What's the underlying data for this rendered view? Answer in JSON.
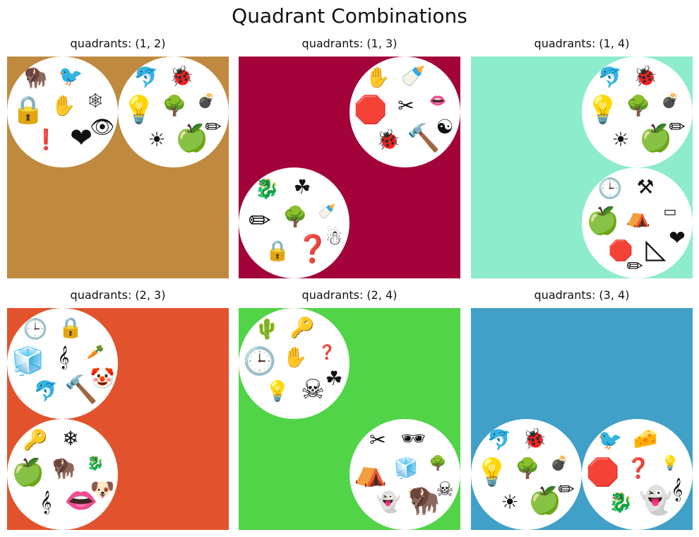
{
  "figure": {
    "title": "Quadrant Combinations"
  },
  "panels": [
    {
      "title": "quadrants: (1, 2)",
      "background": "#bf8a3f",
      "cards": [
        {
          "quadrant": 1,
          "symbols": [
            "bison-icon",
            "bird-icon",
            "lock-icon",
            "hand-icon",
            "spiderweb-icon",
            "exclamation-icon",
            "heart-icon",
            "eye-icon"
          ]
        },
        {
          "quadrant": 2,
          "symbols": [
            "dolphin-icon",
            "ladybug-icon",
            "lightbulb-icon",
            "tree-icon",
            "bomb-icon",
            "sun-icon",
            "apple-icon",
            "pencil-icon"
          ]
        }
      ]
    },
    {
      "title": "quadrants: (1, 3)",
      "background": "#a3023b",
      "cards": [
        {
          "quadrant": 2,
          "symbols": [
            "hand-icon",
            "baby-bottle-icon",
            "stop-sign-icon",
            "scissors-icon",
            "lips-icon",
            "ladybug-icon",
            "hammer-icon",
            "yin-yang-icon"
          ]
        },
        {
          "quadrant": 3,
          "symbols": [
            "dragon-icon",
            "clover-icon",
            "pencil-icon",
            "tree-icon",
            "baby-bottle-icon",
            "lock-icon",
            "question-icon",
            "snowman-icon"
          ]
        }
      ]
    },
    {
      "title": "quadrants: (1, 4)",
      "background": "#8ceccb",
      "cards": [
        {
          "quadrant": 2,
          "symbols": [
            "dolphin-icon",
            "ladybug-icon",
            "lightbulb-icon",
            "tree-icon",
            "bomb-icon",
            "sun-icon",
            "apple-icon",
            "pencil-icon"
          ]
        },
        {
          "quadrant": 4,
          "symbols": [
            "clock-icon",
            "anvil-icon",
            "apple-icon",
            "igloo-icon",
            "eraser-icon",
            "stop-sign-icon",
            "ice-icon",
            "heart-icon",
            "pencil-icon"
          ]
        }
      ]
    },
    {
      "title": "quadrants: (2, 3)",
      "background": "#e2532d",
      "cards": [
        {
          "quadrant": 1,
          "symbols": [
            "clock-icon",
            "lock-icon",
            "ice-cube-icon",
            "treble-clef-icon",
            "carrot-icon",
            "dolphin-icon",
            "hammer-icon",
            "clown-icon"
          ]
        },
        {
          "quadrant": 3,
          "symbols": [
            "key-icon",
            "snowflake-icon",
            "apple-icon",
            "bison-icon",
            "dragon-icon",
            "treble-clef-icon",
            "lips-icon",
            "dog-icon"
          ]
        }
      ]
    },
    {
      "title": "quadrants: (2, 4)",
      "background": "#51d447",
      "cards": [
        {
          "quadrant": 1,
          "symbols": [
            "cactus-icon",
            "key-icon",
            "clock-icon",
            "hand-icon",
            "question-icon",
            "lightbulb-icon",
            "skull-icon",
            "clover-icon"
          ]
        },
        {
          "quadrant": 4,
          "symbols": [
            "scissors-icon",
            "sunglasses-icon",
            "igloo-icon",
            "ice-cube-icon",
            "tree-icon",
            "ghost-icon",
            "bison-icon",
            "skull-icon"
          ]
        }
      ]
    },
    {
      "title": "quadrants: (3, 4)",
      "background": "#40a0c7",
      "cards": [
        {
          "quadrant": 3,
          "symbols": [
            "dolphin-icon",
            "ladybug-icon",
            "lightbulb-icon",
            "tree-icon",
            "bomb-icon",
            "sun-icon",
            "apple-icon",
            "pencil-icon"
          ]
        },
        {
          "quadrant": 4,
          "symbols": [
            "bird-icon",
            "cheese-icon",
            "stop-sign-icon",
            "question-icon",
            "lightbulb-icon",
            "dragon-icon",
            "ghost-icon",
            "treble-clef-icon"
          ]
        }
      ]
    }
  ]
}
